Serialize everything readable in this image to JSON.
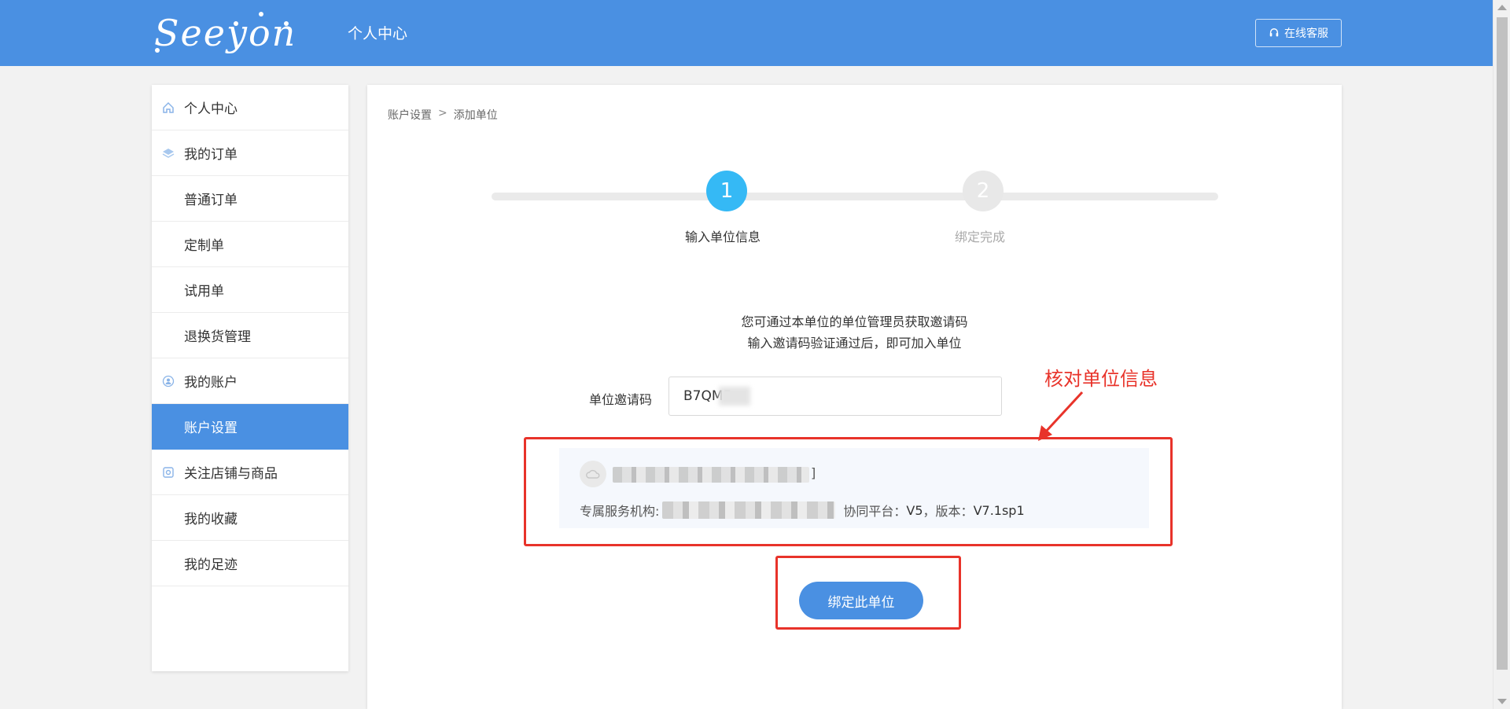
{
  "header": {
    "logo_text": "Seeyon",
    "title": "个人中心",
    "service_label": "在线客服",
    "service_icon": "headset-icon"
  },
  "sidebar": {
    "items": [
      {
        "label": "个人中心",
        "icon": "home-icon",
        "type": "group",
        "active": false
      },
      {
        "label": "我的订单",
        "icon": "layers-icon",
        "type": "group",
        "active": false
      },
      {
        "label": "普通订单",
        "type": "sub",
        "active": false
      },
      {
        "label": "定制单",
        "type": "sub",
        "active": false
      },
      {
        "label": "试用单",
        "type": "sub",
        "active": false
      },
      {
        "label": "退换货管理",
        "type": "sub",
        "active": false
      },
      {
        "label": "我的账户",
        "icon": "user-circle-icon",
        "type": "group",
        "active": false
      },
      {
        "label": "账户设置",
        "type": "sub",
        "active": true
      },
      {
        "label": "关注店铺与商品",
        "icon": "shop-icon",
        "type": "group",
        "active": false
      },
      {
        "label": "我的收藏",
        "type": "sub",
        "active": false
      },
      {
        "label": "我的足迹",
        "type": "sub",
        "active": false
      }
    ]
  },
  "breadcrumb": {
    "parent": "账户设置",
    "separator": ">",
    "current": "添加单位"
  },
  "steps": [
    {
      "number": "1",
      "label": "输入单位信息",
      "active": true
    },
    {
      "number": "2",
      "label": "绑定完成",
      "active": false
    }
  ],
  "hint": {
    "line1": "您可通过本单位的单位管理员获取邀请码",
    "line2": "输入邀请码验证通过后，即可加入单位"
  },
  "invite": {
    "label": "单位邀请码",
    "value": "B7QMF"
  },
  "org_info": {
    "org_name_suffix": "]",
    "service_label": "专属服务机构:",
    "platform_label": "协同平台：",
    "platform_value": "V5",
    "version_label": "，版本：",
    "version_value": "V7.1sp1"
  },
  "bind_button": "绑定此单位",
  "annotation": {
    "text": "核对单位信息"
  },
  "colors": {
    "brand": "#4a90e2",
    "step_active": "#35b9f5",
    "annotation": "#e8332a"
  }
}
